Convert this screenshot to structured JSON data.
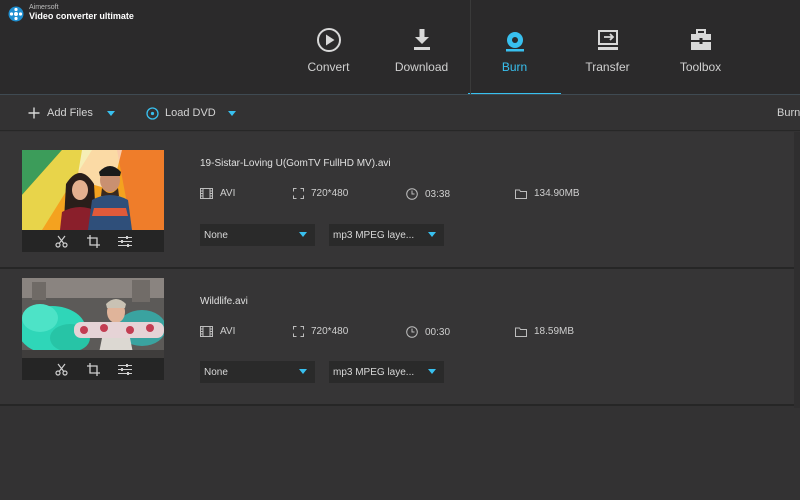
{
  "app": {
    "brand_small": "Aimersoft",
    "brand_name": "Video converter ultimate"
  },
  "nav": [
    {
      "label": "Convert",
      "icon": "play-circle-icon",
      "active": false
    },
    {
      "label": "Download",
      "icon": "download-icon",
      "active": false
    },
    {
      "label": "Burn",
      "icon": "disc-icon",
      "active": true
    },
    {
      "label": "Transfer",
      "icon": "transfer-icon",
      "active": false
    },
    {
      "label": "Toolbox",
      "icon": "toolbox-icon",
      "active": false
    }
  ],
  "toolbar": {
    "add_files": "Add Files",
    "load_dvd": "Load DVD",
    "burn": "Burn"
  },
  "files": [
    {
      "name": "19-Sistar-Loving U(GomTV FullHD MV).avi",
      "format": "AVI",
      "resolution": "720*480",
      "duration": "03:38",
      "size": "134.90MB",
      "subtitle": "None",
      "audio": "mp3 MPEG laye..."
    },
    {
      "name": "Wildlife.avi",
      "format": "AVI",
      "resolution": "720*480",
      "duration": "00:30",
      "size": "18.59MB",
      "subtitle": "None",
      "audio": "mp3 MPEG laye..."
    }
  ],
  "colors": {
    "accent": "#38c0ef",
    "background": "#333233",
    "header": "#2b2a2b"
  }
}
